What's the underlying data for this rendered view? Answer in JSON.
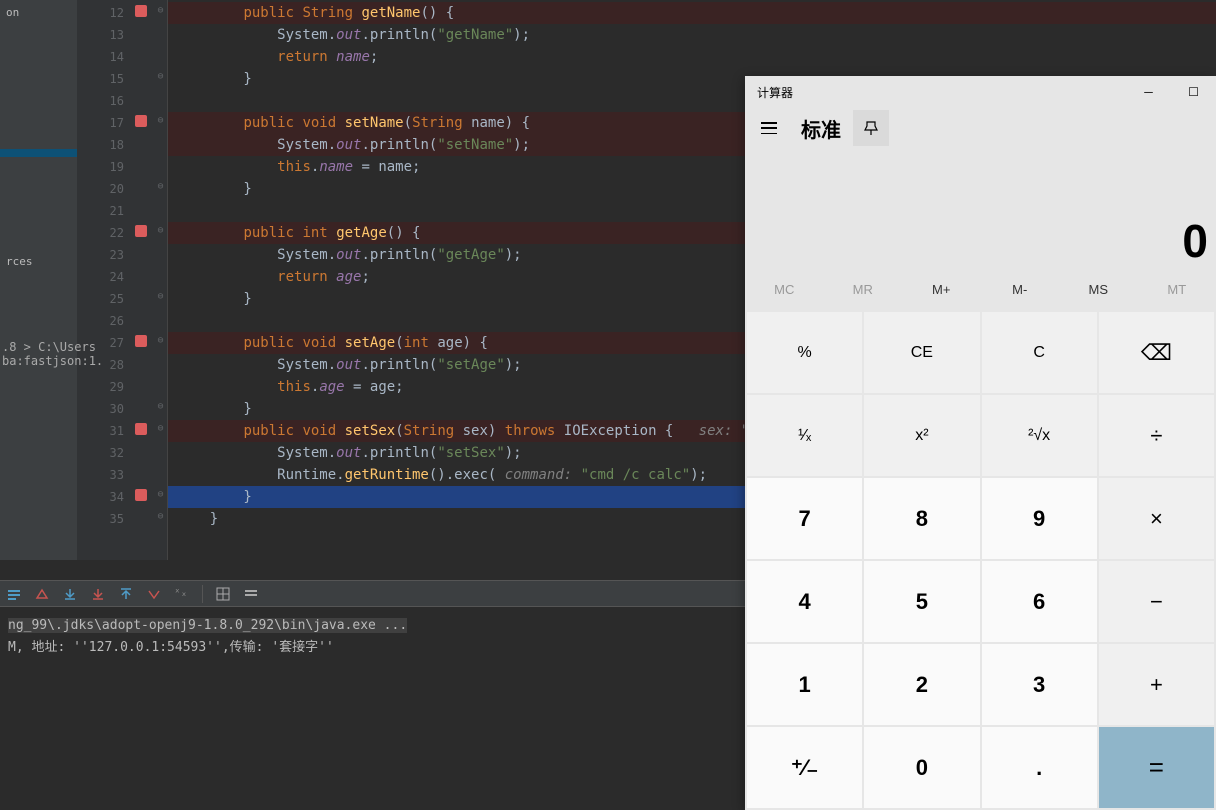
{
  "editor": {
    "sidebar": {
      "items": [
        "on",
        "rces"
      ],
      "highlightIndex": 2
    },
    "path": [
      ".8 >  C:\\Users",
      "ba:fastjson:1."
    ],
    "lines": [
      {
        "num": "12",
        "bp": true,
        "fold": "⊖",
        "hl": true,
        "html": "        <span class='kw'>public</span> <span class='type'>String</span> <span class='fn'>getName</span>() {"
      },
      {
        "num": "13",
        "bp": false,
        "fold": "",
        "hl": false,
        "html": "            System.<span class='outfield'>out</span>.println(<span class='str'>\"getName\"</span>);"
      },
      {
        "num": "14",
        "bp": false,
        "fold": "",
        "hl": false,
        "html": "            <span class='kw'>return</span> <span class='field'>name</span>;"
      },
      {
        "num": "15",
        "bp": false,
        "fold": "⊖",
        "hl": false,
        "html": "        }"
      },
      {
        "num": "16",
        "bp": false,
        "fold": "",
        "hl": false,
        "html": ""
      },
      {
        "num": "17",
        "bp": true,
        "fold": "⊖",
        "hl": true,
        "html": "        <span class='kw'>public</span> <span class='kw'>void</span> <span class='fn'>setName</span>(<span class='type'>String</span> name) {"
      },
      {
        "num": "18",
        "bp": false,
        "fold": "",
        "hl": true,
        "html": "            System.<span class='outfield'>out</span>.println(<span class='str'>\"setName\"</span>);"
      },
      {
        "num": "19",
        "bp": false,
        "fold": "",
        "hl": false,
        "html": "            <span class='kw'>this</span>.<span class='field'>name</span> = name;"
      },
      {
        "num": "20",
        "bp": false,
        "fold": "⊖",
        "hl": false,
        "html": "        }"
      },
      {
        "num": "21",
        "bp": false,
        "fold": "",
        "hl": false,
        "html": ""
      },
      {
        "num": "22",
        "bp": true,
        "fold": "⊖",
        "hl": true,
        "html": "        <span class='kw'>public</span> <span class='kw'>int</span> <span class='fn'>getAge</span>() {"
      },
      {
        "num": "23",
        "bp": false,
        "fold": "",
        "hl": false,
        "html": "            System.<span class='outfield'>out</span>.println(<span class='str'>\"getAge\"</span>);"
      },
      {
        "num": "24",
        "bp": false,
        "fold": "",
        "hl": false,
        "html": "            <span class='kw'>return</span> <span class='field'>age</span>;"
      },
      {
        "num": "25",
        "bp": false,
        "fold": "⊖",
        "hl": false,
        "html": "        }"
      },
      {
        "num": "26",
        "bp": false,
        "fold": "",
        "hl": false,
        "html": ""
      },
      {
        "num": "27",
        "bp": true,
        "fold": "⊖",
        "hl": true,
        "html": "        <span class='kw'>public</span> <span class='kw'>void</span> <span class='fn'>setAge</span>(<span class='kw'>int</span> age) {"
      },
      {
        "num": "28",
        "bp": false,
        "fold": "",
        "hl": false,
        "html": "            System.<span class='outfield'>out</span>.println(<span class='str'>\"setAge\"</span>);"
      },
      {
        "num": "29",
        "bp": false,
        "fold": "",
        "hl": false,
        "html": "            <span class='kw'>this</span>.<span class='field'>age</span> = age;"
      },
      {
        "num": "30",
        "bp": false,
        "fold": "⊖",
        "hl": false,
        "html": "        }"
      },
      {
        "num": "31",
        "bp": true,
        "fold": "⊖",
        "hl": true,
        "html": "        <span class='kw'>public</span> <span class='kw'>void</span> <span class='fn'>setSex</span>(<span class='type'>String</span> sex) <span class='kw'>throws</span> IOException {   <span class='comment'>sex: \"man\"</span>"
      },
      {
        "num": "32",
        "bp": false,
        "fold": "",
        "hl": false,
        "html": "            System.<span class='outfield'>out</span>.println(<span class='str'>\"setSex\"</span>);"
      },
      {
        "num": "33",
        "bp": false,
        "fold": "",
        "hl": false,
        "html": "            Runtime.<span class='fn'>getRuntime</span>().exec( <span class='comment'>command:</span> <span class='str'>\"cmd /c calc\"</span>);"
      },
      {
        "num": "34",
        "bp": true,
        "fold": "⊖",
        "cur": true,
        "html": "        }"
      },
      {
        "num": "35",
        "bp": false,
        "fold": "⊖",
        "hl": false,
        "html": "    }"
      }
    ]
  },
  "console": {
    "line1": "ng_99\\.jdks\\adopt-openj9-1.8.0_292\\bin\\java.exe ...",
    "line2": "M, 地址: ''127.0.0.1:54593'',传输: '套接字''"
  },
  "calculator": {
    "title": "计算器",
    "mode": "标准",
    "display": "0",
    "memory": [
      "MC",
      "MR",
      "M+",
      "M-",
      "MS",
      "MT"
    ],
    "keys": [
      [
        "%",
        "CE",
        "C",
        "⌫"
      ],
      [
        "¹⁄ₓ",
        "x²",
        "²√x",
        "÷"
      ],
      [
        "7",
        "8",
        "9",
        "×"
      ],
      [
        "4",
        "5",
        "6",
        "−"
      ],
      [
        "1",
        "2",
        "3",
        "+"
      ],
      [
        "⁺⁄₋",
        "0",
        ".",
        "="
      ]
    ]
  }
}
